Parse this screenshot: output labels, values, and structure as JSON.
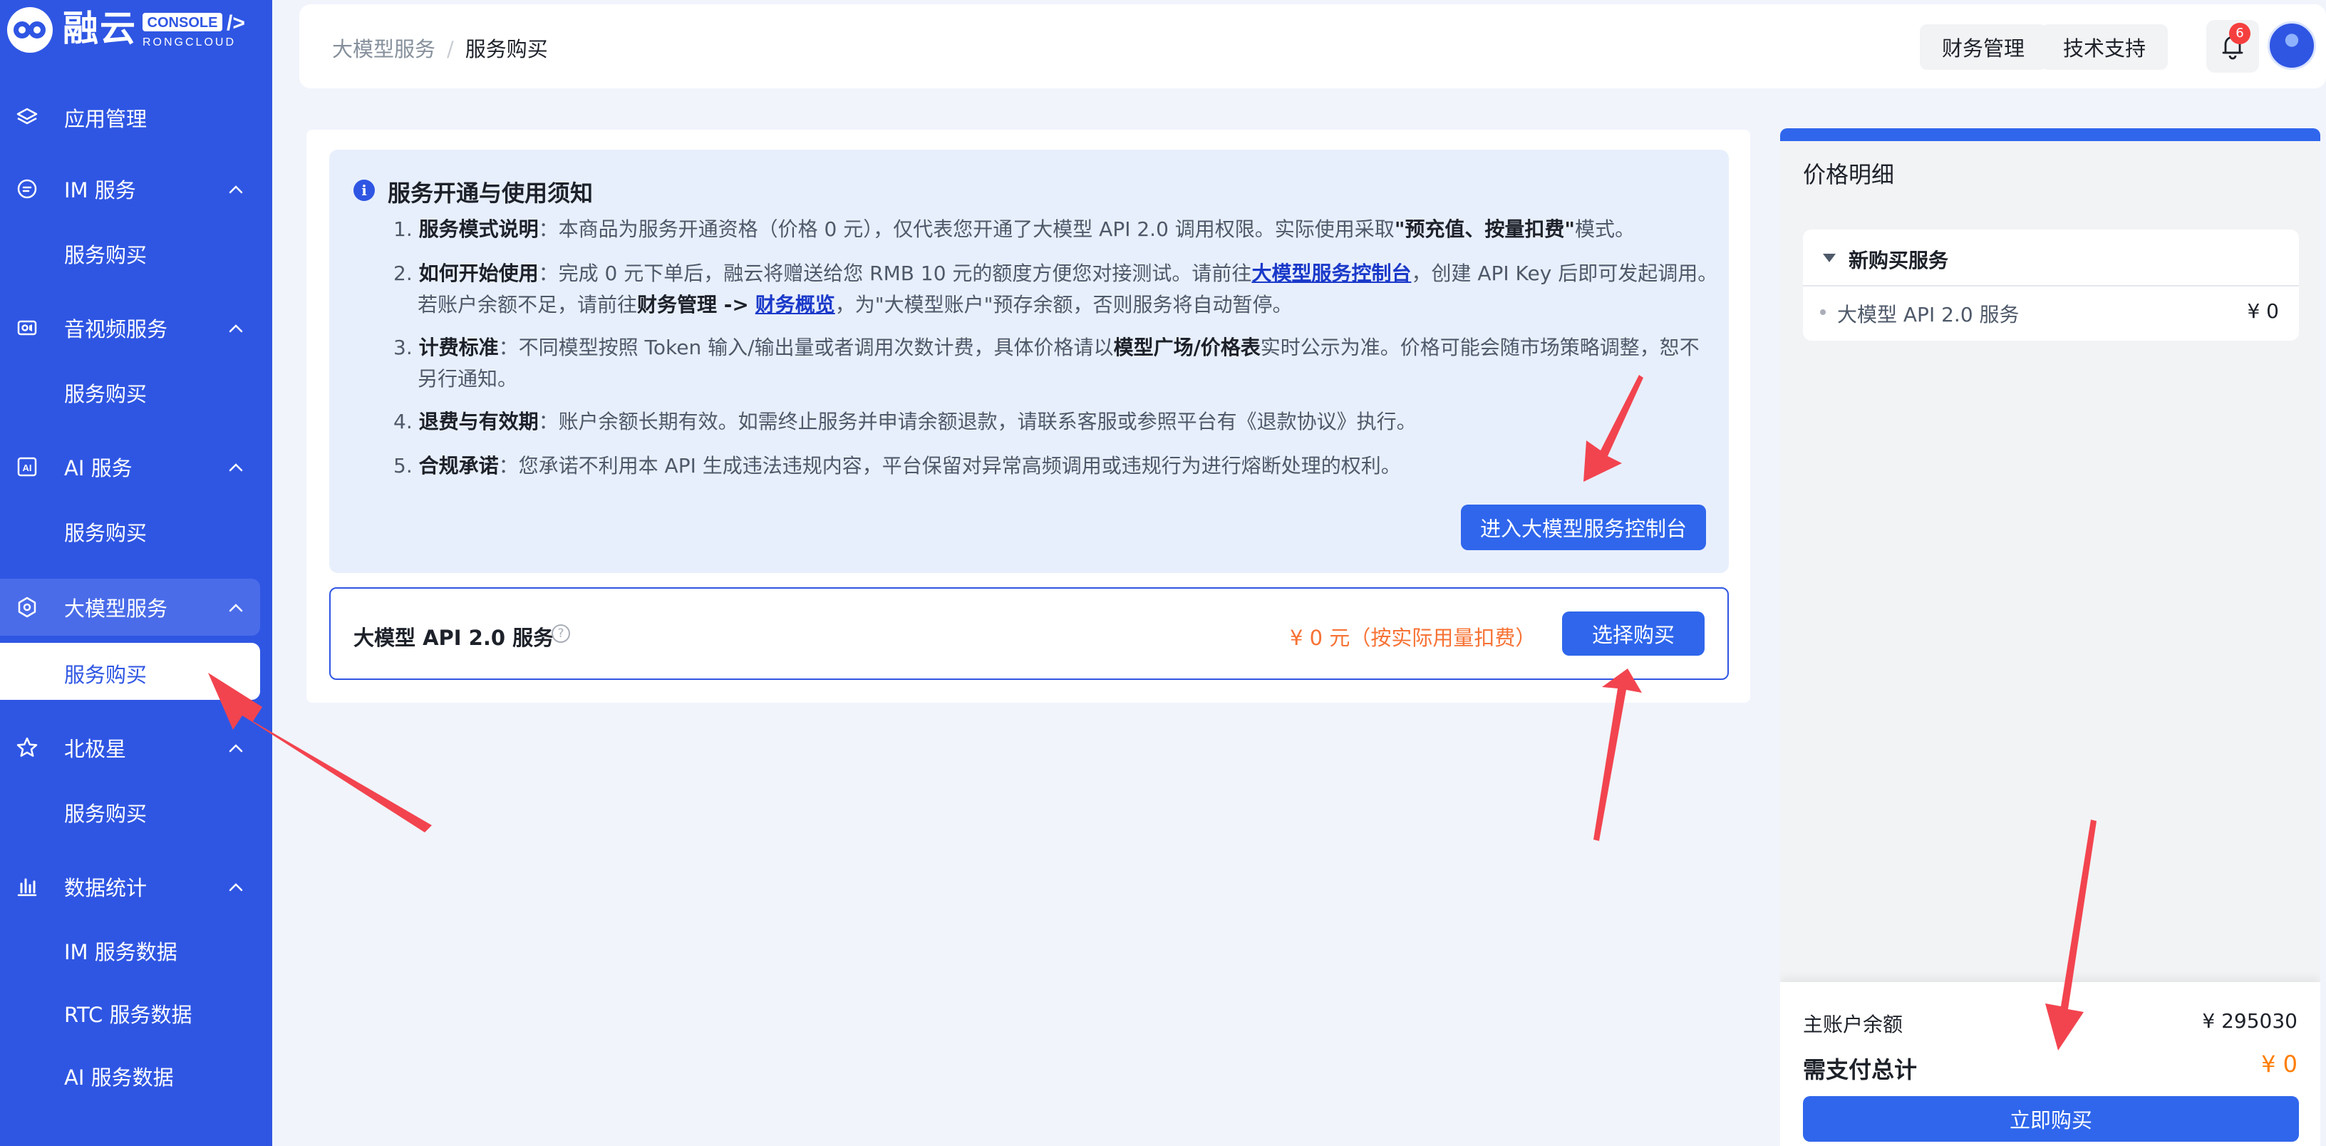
{
  "logo": {
    "name": "融云"
  },
  "sidebar": {
    "items": [
      {
        "label": "应用管理",
        "icon": "layers-icon"
      },
      {
        "label": "IM 服务",
        "icon": "chat-icon",
        "sub": "服务购买"
      },
      {
        "label": "音视频服务",
        "icon": "video-icon",
        "sub": "服务购买"
      },
      {
        "label": "AI 服务",
        "icon": "ai-icon",
        "sub": "服务购买"
      },
      {
        "label": "大模型服务",
        "icon": "model-icon",
        "sub": "服务购买"
      },
      {
        "label": "北极星",
        "icon": "star-icon",
        "sub": "服务购买"
      },
      {
        "label": "数据统计",
        "icon": "bar-chart-icon",
        "subs": [
          "IM 服务数据",
          "RTC 服务数据",
          "AI 服务数据"
        ]
      }
    ]
  },
  "header": {
    "breadcrumb": [
      "大模型服务",
      "服务购买"
    ],
    "separator": "/",
    "finance_btn": "财务管理",
    "support_btn": "技术支持",
    "notification_count": "6"
  },
  "notice": {
    "title": "服务开通与使用须知",
    "items": [
      {
        "num": "1.",
        "bold": "服务模式说明",
        "text": "本商品为服务开通资格（价格 0 元），仅代表您开通了大模型 API 2.0 调用权限。实际使用采取",
        "emph": "\"预充值、按量扣费\"",
        "tail": "模式。"
      },
      {
        "num": "2.",
        "bold": "如何开始使用",
        "text1": "完成 0 元下单后，融云将赠送给您 RMB 10 元的额度方便您对接测试。请前往",
        "link1": "大模型服务控制台",
        "text2": "，创建 API Key 后即可发起调用。",
        "text3": "若账户余额不足，请前往",
        "bold2": "财务管理 ->",
        "link2": "财务概览",
        "text4": "，为\"大模型账户\"预存余额，否则服务将自动暂停。"
      },
      {
        "num": "3.",
        "bold": "计费标准",
        "text1": "不同模型按照 Token 输入/输出量或者调用次数计费，具体价格请以",
        "bold2": "模型广场/价格表",
        "text2": "实时公示为准。价格可能会随市场策略调整，恕不",
        "text3": "另行通知。"
      },
      {
        "num": "4.",
        "bold": "退费与有效期",
        "text": "账户余额长期有效。如需终止服务并申请余额退款，请联系客服或参照平台有《退款协议》执行。"
      },
      {
        "num": "5.",
        "bold": "合规承诺",
        "text": "您承诺不利用本 API 生成违法违规内容，平台保留对异常高频调用或违规行为进行熔断处理的权利。"
      }
    ],
    "colon": "：",
    "console_btn": "进入大模型服务控制台"
  },
  "product": {
    "name": "大模型 API 2.0 服务",
    "help_icon": "question-circle-icon",
    "price": "¥ 0 元（按实际用量扣费）",
    "buy_btn": "选择购买"
  },
  "price_panel": {
    "title": "价格明细",
    "section": "新购买服务",
    "item_name": "大模型 API 2.0 服务",
    "item_price": "¥ 0",
    "balance_label": "主账户余额",
    "balance_value": "¥ 295030",
    "total_label": "需支付总计",
    "total_value": "¥ 0",
    "buy_now_btn": "立即购买"
  },
  "colors": {
    "sidebar": "#2f56e3",
    "primary": "#2f66ec",
    "price_orange": "#f77234",
    "arrow_red": "#f2444f"
  }
}
